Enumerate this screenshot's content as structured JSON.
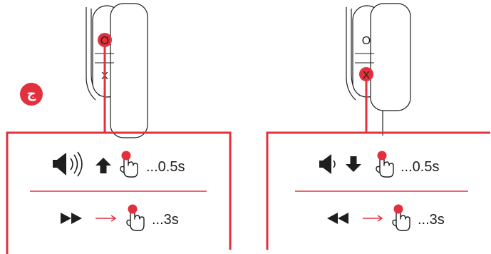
{
  "brand": {
    "badge_text": "ج",
    "accent_color": "#e2303d",
    "ink_color": "#1e1e1e"
  },
  "left_panel": {
    "headphone_buttons": [
      "O",
      "X"
    ],
    "active_button": "O",
    "rows": [
      {
        "icons": [
          "speaker-loud-icon",
          "arrow-up-icon",
          "finger-press-icon"
        ],
        "duration": "...0.5s"
      },
      {
        "icons": [
          "fast-forward-icon",
          "arrow-right-icon",
          "finger-press-icon"
        ],
        "duration": "...3s"
      }
    ]
  },
  "right_panel": {
    "headphone_buttons": [
      "O",
      "X"
    ],
    "active_button": "X",
    "rows": [
      {
        "icons": [
          "speaker-quiet-icon",
          "arrow-down-icon",
          "finger-press-icon"
        ],
        "duration": "...0.5s"
      },
      {
        "icons": [
          "rewind-icon",
          "arrow-right-icon",
          "finger-press-icon"
        ],
        "duration": "...3s"
      }
    ]
  }
}
